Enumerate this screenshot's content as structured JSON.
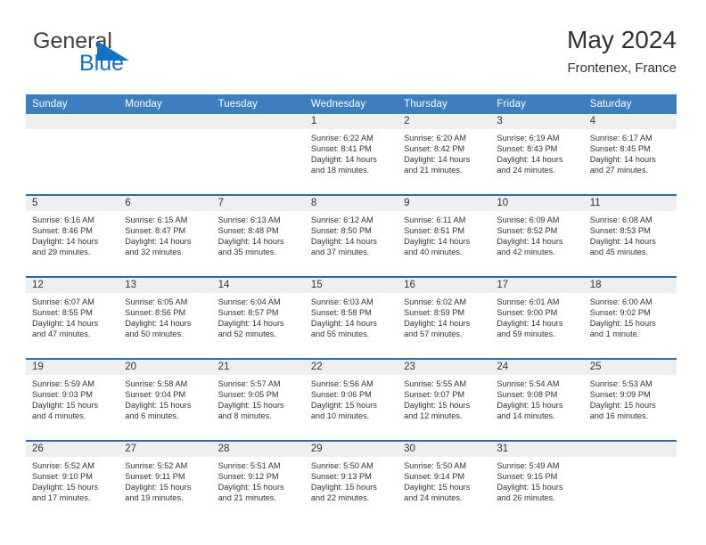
{
  "brand": {
    "word_top": "General",
    "word_bottom": "Blue",
    "triangle_color": "#1272c4",
    "text_color": "#3f3f3f",
    "blue_color": "#1272c4",
    "icon": "triangle-icon"
  },
  "header": {
    "title": "May 2024",
    "subtitle": "Frontenex, France"
  },
  "theme": {
    "header_blue": "#3d7ebf",
    "row_rule": "#2e6da4",
    "daynum_band": "#efefef",
    "text": "#333333"
  },
  "weekday_headers": [
    "Sunday",
    "Monday",
    "Tuesday",
    "Wednesday",
    "Thursday",
    "Friday",
    "Saturday"
  ],
  "labels": {
    "sunrise": "Sunrise:",
    "sunset": "Sunset:",
    "daylight": "Daylight:"
  },
  "weeks": [
    [
      {
        "day": ""
      },
      {
        "day": ""
      },
      {
        "day": ""
      },
      {
        "day": "1",
        "sunrise": "Sunrise: 6:22 AM",
        "sunset": "Sunset: 8:41 PM",
        "daylight_line1": "Daylight: 14 hours",
        "daylight_line2": "and 18 minutes."
      },
      {
        "day": "2",
        "sunrise": "Sunrise: 6:20 AM",
        "sunset": "Sunset: 8:42 PM",
        "daylight_line1": "Daylight: 14 hours",
        "daylight_line2": "and 21 minutes."
      },
      {
        "day": "3",
        "sunrise": "Sunrise: 6:19 AM",
        "sunset": "Sunset: 8:43 PM",
        "daylight_line1": "Daylight: 14 hours",
        "daylight_line2": "and 24 minutes."
      },
      {
        "day": "4",
        "sunrise": "Sunrise: 6:17 AM",
        "sunset": "Sunset: 8:45 PM",
        "daylight_line1": "Daylight: 14 hours",
        "daylight_line2": "and 27 minutes."
      }
    ],
    [
      {
        "day": "5",
        "sunrise": "Sunrise: 6:16 AM",
        "sunset": "Sunset: 8:46 PM",
        "daylight_line1": "Daylight: 14 hours",
        "daylight_line2": "and 29 minutes."
      },
      {
        "day": "6",
        "sunrise": "Sunrise: 6:15 AM",
        "sunset": "Sunset: 8:47 PM",
        "daylight_line1": "Daylight: 14 hours",
        "daylight_line2": "and 32 minutes."
      },
      {
        "day": "7",
        "sunrise": "Sunrise: 6:13 AM",
        "sunset": "Sunset: 8:48 PM",
        "daylight_line1": "Daylight: 14 hours",
        "daylight_line2": "and 35 minutes."
      },
      {
        "day": "8",
        "sunrise": "Sunrise: 6:12 AM",
        "sunset": "Sunset: 8:50 PM",
        "daylight_line1": "Daylight: 14 hours",
        "daylight_line2": "and 37 minutes."
      },
      {
        "day": "9",
        "sunrise": "Sunrise: 6:11 AM",
        "sunset": "Sunset: 8:51 PM",
        "daylight_line1": "Daylight: 14 hours",
        "daylight_line2": "and 40 minutes."
      },
      {
        "day": "10",
        "sunrise": "Sunrise: 6:09 AM",
        "sunset": "Sunset: 8:52 PM",
        "daylight_line1": "Daylight: 14 hours",
        "daylight_line2": "and 42 minutes."
      },
      {
        "day": "11",
        "sunrise": "Sunrise: 6:08 AM",
        "sunset": "Sunset: 8:53 PM",
        "daylight_line1": "Daylight: 14 hours",
        "daylight_line2": "and 45 minutes."
      }
    ],
    [
      {
        "day": "12",
        "sunrise": "Sunrise: 6:07 AM",
        "sunset": "Sunset: 8:55 PM",
        "daylight_line1": "Daylight: 14 hours",
        "daylight_line2": "and 47 minutes."
      },
      {
        "day": "13",
        "sunrise": "Sunrise: 6:05 AM",
        "sunset": "Sunset: 8:56 PM",
        "daylight_line1": "Daylight: 14 hours",
        "daylight_line2": "and 50 minutes."
      },
      {
        "day": "14",
        "sunrise": "Sunrise: 6:04 AM",
        "sunset": "Sunset: 8:57 PM",
        "daylight_line1": "Daylight: 14 hours",
        "daylight_line2": "and 52 minutes."
      },
      {
        "day": "15",
        "sunrise": "Sunrise: 6:03 AM",
        "sunset": "Sunset: 8:58 PM",
        "daylight_line1": "Daylight: 14 hours",
        "daylight_line2": "and 55 minutes."
      },
      {
        "day": "16",
        "sunrise": "Sunrise: 6:02 AM",
        "sunset": "Sunset: 8:59 PM",
        "daylight_line1": "Daylight: 14 hours",
        "daylight_line2": "and 57 minutes."
      },
      {
        "day": "17",
        "sunrise": "Sunrise: 6:01 AM",
        "sunset": "Sunset: 9:00 PM",
        "daylight_line1": "Daylight: 14 hours",
        "daylight_line2": "and 59 minutes."
      },
      {
        "day": "18",
        "sunrise": "Sunrise: 6:00 AM",
        "sunset": "Sunset: 9:02 PM",
        "daylight_line1": "Daylight: 15 hours",
        "daylight_line2": "and 1 minute."
      }
    ],
    [
      {
        "day": "19",
        "sunrise": "Sunrise: 5:59 AM",
        "sunset": "Sunset: 9:03 PM",
        "daylight_line1": "Daylight: 15 hours",
        "daylight_line2": "and 4 minutes."
      },
      {
        "day": "20",
        "sunrise": "Sunrise: 5:58 AM",
        "sunset": "Sunset: 9:04 PM",
        "daylight_line1": "Daylight: 15 hours",
        "daylight_line2": "and 6 minutes."
      },
      {
        "day": "21",
        "sunrise": "Sunrise: 5:57 AM",
        "sunset": "Sunset: 9:05 PM",
        "daylight_line1": "Daylight: 15 hours",
        "daylight_line2": "and 8 minutes."
      },
      {
        "day": "22",
        "sunrise": "Sunrise: 5:56 AM",
        "sunset": "Sunset: 9:06 PM",
        "daylight_line1": "Daylight: 15 hours",
        "daylight_line2": "and 10 minutes."
      },
      {
        "day": "23",
        "sunrise": "Sunrise: 5:55 AM",
        "sunset": "Sunset: 9:07 PM",
        "daylight_line1": "Daylight: 15 hours",
        "daylight_line2": "and 12 minutes."
      },
      {
        "day": "24",
        "sunrise": "Sunrise: 5:54 AM",
        "sunset": "Sunset: 9:08 PM",
        "daylight_line1": "Daylight: 15 hours",
        "daylight_line2": "and 14 minutes."
      },
      {
        "day": "25",
        "sunrise": "Sunrise: 5:53 AM",
        "sunset": "Sunset: 9:09 PM",
        "daylight_line1": "Daylight: 15 hours",
        "daylight_line2": "and 16 minutes."
      }
    ],
    [
      {
        "day": "26",
        "sunrise": "Sunrise: 5:52 AM",
        "sunset": "Sunset: 9:10 PM",
        "daylight_line1": "Daylight: 15 hours",
        "daylight_line2": "and 17 minutes."
      },
      {
        "day": "27",
        "sunrise": "Sunrise: 5:52 AM",
        "sunset": "Sunset: 9:11 PM",
        "daylight_line1": "Daylight: 15 hours",
        "daylight_line2": "and 19 minutes."
      },
      {
        "day": "28",
        "sunrise": "Sunrise: 5:51 AM",
        "sunset": "Sunset: 9:12 PM",
        "daylight_line1": "Daylight: 15 hours",
        "daylight_line2": "and 21 minutes."
      },
      {
        "day": "29",
        "sunrise": "Sunrise: 5:50 AM",
        "sunset": "Sunset: 9:13 PM",
        "daylight_line1": "Daylight: 15 hours",
        "daylight_line2": "and 22 minutes."
      },
      {
        "day": "30",
        "sunrise": "Sunrise: 5:50 AM",
        "sunset": "Sunset: 9:14 PM",
        "daylight_line1": "Daylight: 15 hours",
        "daylight_line2": "and 24 minutes."
      },
      {
        "day": "31",
        "sunrise": "Sunrise: 5:49 AM",
        "sunset": "Sunset: 9:15 PM",
        "daylight_line1": "Daylight: 15 hours",
        "daylight_line2": "and 26 minutes."
      },
      {
        "day": ""
      }
    ]
  ]
}
